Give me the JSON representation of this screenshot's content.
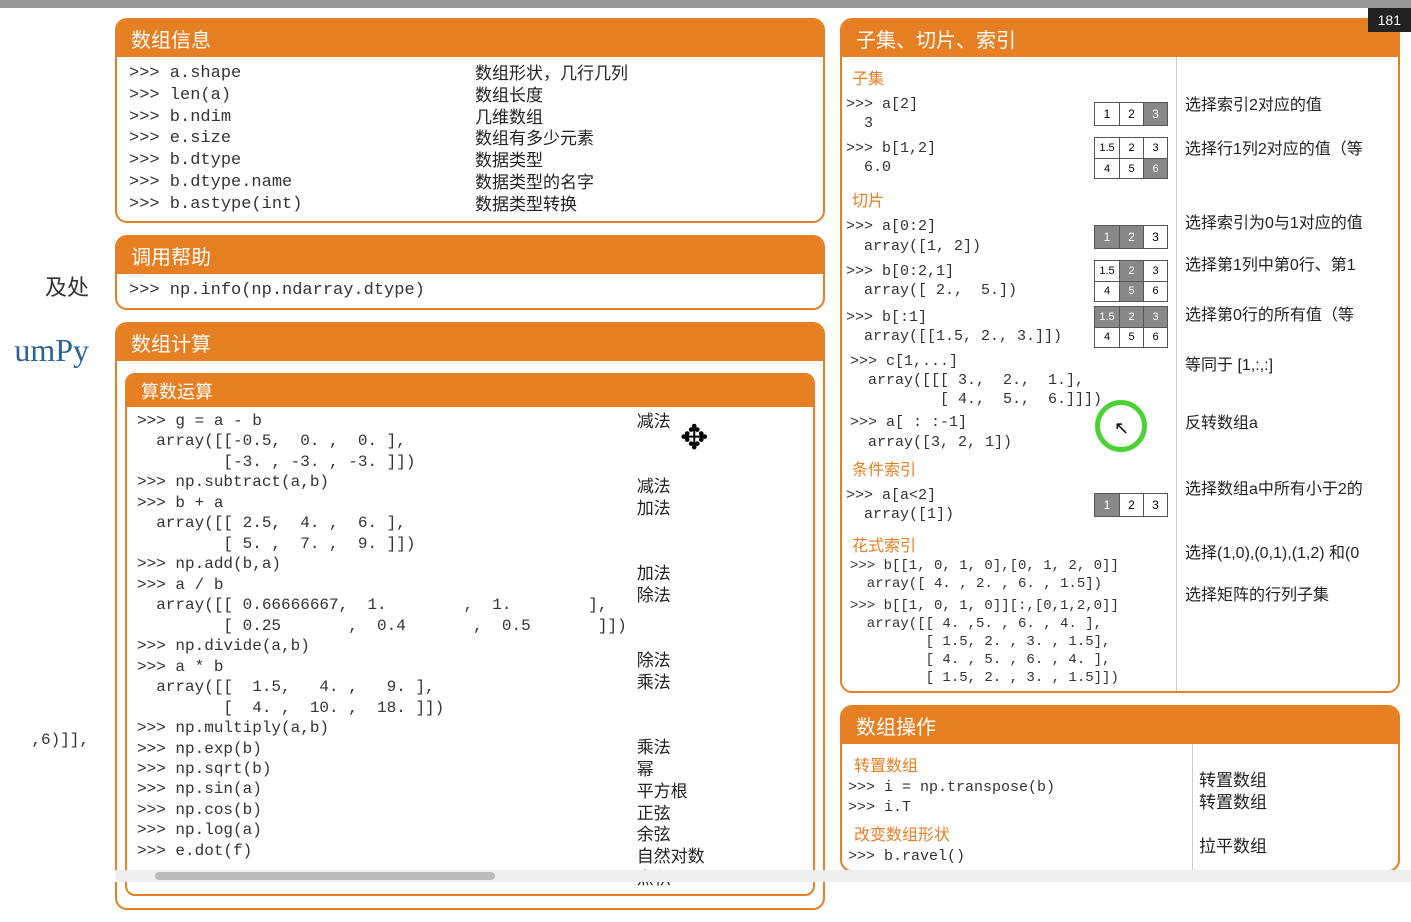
{
  "page_counter": "181",
  "left_fragments": {
    "t1": "及处",
    "t2": "umPy",
    "t3": ",6)]],"
  },
  "arrayinfo": {
    "title": "数组信息",
    "code": ">>> a.shape\n>>> len(a)\n>>> b.ndim\n>>> e.size\n>>> b.dtype\n>>> b.dtype.name\n>>> b.astype(int)",
    "desc": "数组形状，几行几列\n数组长度\n几维数组\n数组有多少元素\n数据类型\n数据类型的名字\n数据类型转换"
  },
  "help": {
    "title": "调用帮助",
    "code": ">>> np.info(np.ndarray.dtype)"
  },
  "calc": {
    "title": "数组计算",
    "arith_title": "算数运算",
    "code": ">>> g = a - b\n  array([[-0.5,  0. ,  0. ],\n         [-3. , -3. , -3. ]])\n>>> np.subtract(a,b)\n>>> b + a\n  array([[ 2.5,  4. ,  6. ],\n         [ 5. ,  7. ,  9. ]])\n>>> np.add(b,a)\n>>> a / b\n  array([[ 0.66666667,  1.        ,  1.        ],\n         [ 0.25       ,  0.4       ,  0.5       ]])\n>>> np.divide(a,b)\n>>> a * b\n  array([[  1.5,   4. ,   9. ],\n         [  4. ,  10. ,  18. ]])\n>>> np.multiply(a,b)\n>>> np.exp(b)\n>>> np.sqrt(b)\n>>> np.sin(a)\n>>> np.cos(b)\n>>> np.log(a)\n>>> e.dot(f)",
    "desc": "减法\n\n\n减法\n加法\n\n\n加法\n除法\n\n\n除法\n乘法\n\n\n乘法\n幂\n平方根\n正弦\n余弦\n自然对数\n点积"
  },
  "indexing": {
    "title": "子集、切片、索引",
    "subset_label": "子集",
    "slice_label": "切片",
    "cond_label": "条件索引",
    "fancy_label": "花式索引",
    "r1_code": ">>> a[2]\n  3",
    "r1_desc": "选择索引2对应的值",
    "r2_code": ">>> b[1,2]\n  6.0",
    "r2_desc": "选择行1列2对应的值（等",
    "r3_code": ">>> a[0:2]\n  array([1, 2])",
    "r3_desc": "选择索引为0与1对应的值",
    "r4_code": ">>> b[0:2,1]\n  array([ 2.,  5.])",
    "r4_desc": "选择第1列中第0行、第1",
    "r5_code": ">>> b[:1]\n  array([[1.5, 2., 3.]])",
    "r5_desc": "选择第0行的所有值（等",
    "r6_code": ">>> c[1,...]\n  array([[[ 3.,  2.,  1.],\n          [ 4.,  5.,  6.]]])",
    "r6_desc": "等同于 [1,:,:]",
    "r7_code": ">>> a[ : :-1]\n  array([3, 2, 1])",
    "r7_desc": "反转数组a",
    "r8_code": ">>> a[a<2]\n  array([1])",
    "r8_desc": "选择数组a中所有小于2的",
    "r9_code": ">>> b[[1, 0, 1, 0],[0, 1, 2, 0]]\n  array([ 4. , 2. , 6. , 1.5])",
    "r9_desc": "选择(1,0),(0,1),(1,2) 和(0",
    "r10_code": ">>> b[[1, 0, 1, 0]][:,[0,1,2,0]]\n  array([[ 4. ,5. , 6. , 4. ],\n         [ 1.5, 2. , 3. , 1.5],\n         [ 4. , 5. , 6. , 4. ],\n         [ 1.5, 2. , 3. , 1.5]])",
    "r10_desc": "选择矩阵的行列子集",
    "chart_data": {
      "type": "table",
      "arrays": {
        "a_1x3": [
          1,
          2,
          3
        ],
        "b_2x3": [
          [
            1.5,
            2,
            3
          ],
          [
            4,
            5,
            6
          ]
        ]
      },
      "selections": [
        {
          "op": "a[2]",
          "highlight": [
            2
          ]
        },
        {
          "op": "b[1,2]",
          "highlight": [
            [
              1,
              2
            ]
          ]
        },
        {
          "op": "a[0:2]",
          "highlight": [
            0,
            1
          ]
        },
        {
          "op": "b[0:2,1]",
          "highlight": [
            [
              0,
              1
            ],
            [
              1,
              1
            ]
          ]
        },
        {
          "op": "b[:1]",
          "highlight": [
            [
              0,
              0
            ],
            [
              0,
              1
            ],
            [
              0,
              2
            ]
          ]
        },
        {
          "op": "a[a<2]",
          "highlight": [
            0
          ]
        }
      ]
    }
  },
  "ops": {
    "title": "数组操作",
    "transpose_label": "转置数组",
    "transpose_code": ">>> i = np.transpose(b)\n>>> i.T",
    "transpose_desc": "转置数组\n转置数组",
    "reshape_label": "改变数组形状",
    "reshape_code": ">>> b.ravel()",
    "reshape_desc": "拉平数组"
  }
}
